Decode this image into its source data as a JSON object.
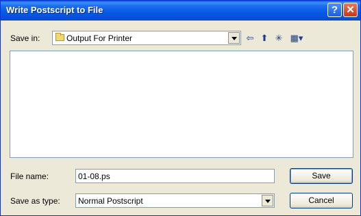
{
  "window": {
    "title": "Write Postscript to File"
  },
  "titlebar": {
    "help_glyph": "?",
    "close_glyph": "✕"
  },
  "save_in": {
    "label": "Save in:",
    "value": "Output For Printer"
  },
  "toolbar": {
    "back_glyph": "⇦",
    "up_glyph": "⬆",
    "new_folder_glyph": "✳",
    "view_glyph": "▦▾"
  },
  "file_name": {
    "label": "File name:",
    "value": "01-08.ps"
  },
  "save_as_type": {
    "label": "Save as type:",
    "value": "Normal Postscript"
  },
  "buttons": {
    "save": "Save",
    "cancel": "Cancel"
  },
  "colors": {
    "titlebar": "#0758e6",
    "background": "#ece9d8",
    "close": "#c4391b"
  }
}
